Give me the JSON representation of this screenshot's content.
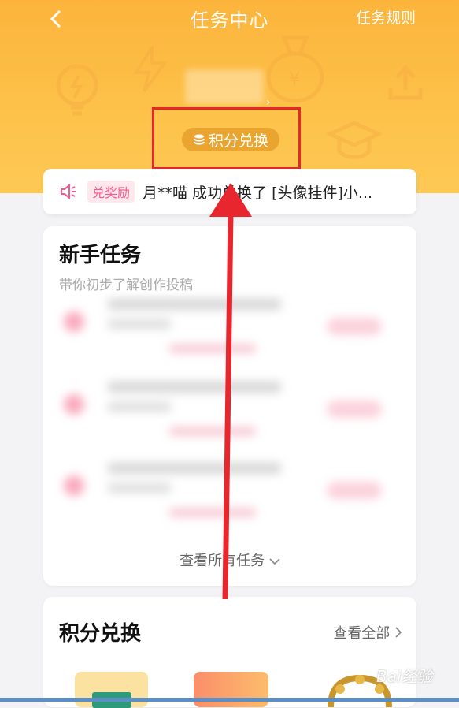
{
  "header": {
    "back_icon": "chevron-left-icon",
    "title": "任务中心",
    "rules_label": "任务规则",
    "points_button_label": "积分兑换",
    "points_icon": "coin-stack-icon"
  },
  "notice": {
    "icon": "speaker-icon",
    "tag": "兑奖励",
    "message": "月**喵 成功兑换了 [头像挂件]小..."
  },
  "newbie_tasks": {
    "title": "新手任务",
    "subtitle": "带你初步了解创作投稿",
    "view_all_label": "查看所有任务"
  },
  "points_exchange": {
    "title": "积分兑换",
    "see_all_label": "查看全部"
  },
  "watermark": {
    "text": "Bai经验"
  },
  "colors": {
    "header": "#fcb43c",
    "highlight": "#e8262e",
    "tag": "#f5588a"
  }
}
